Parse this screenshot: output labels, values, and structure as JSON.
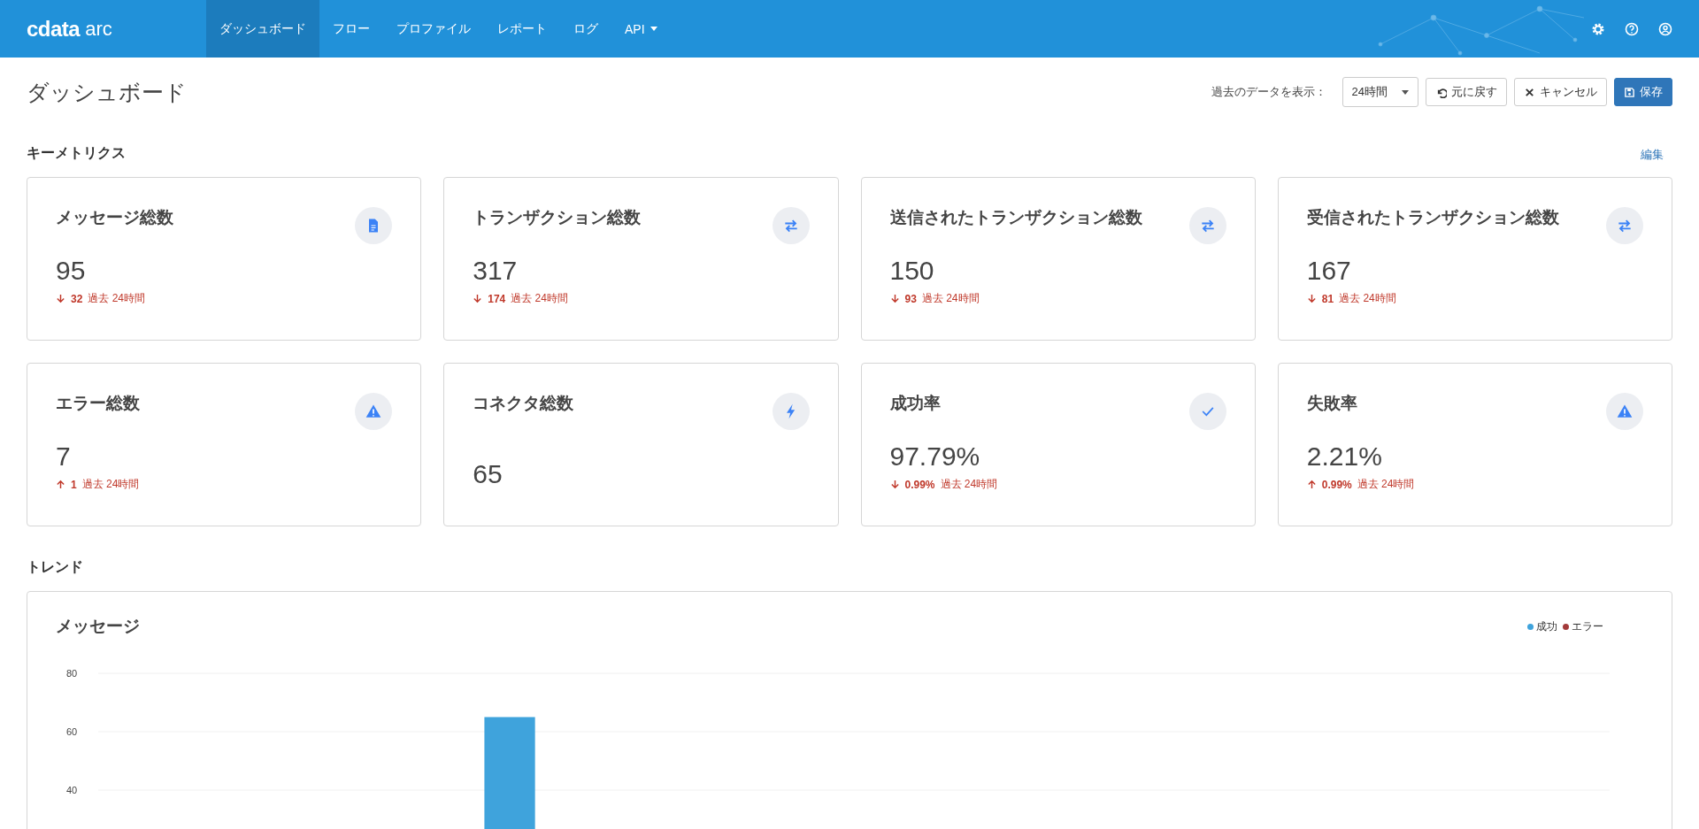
{
  "header": {
    "logo": {
      "brand": "cdata",
      "product": "arc"
    },
    "nav": [
      {
        "label": "ダッシュボード",
        "selected": true,
        "dropdown": false
      },
      {
        "label": "フロー",
        "selected": false,
        "dropdown": false
      },
      {
        "label": "プロファイル",
        "selected": false,
        "dropdown": false
      },
      {
        "label": "レポート",
        "selected": false,
        "dropdown": false
      },
      {
        "label": "ログ",
        "selected": false,
        "dropdown": false
      },
      {
        "label": "API",
        "selected": false,
        "dropdown": true
      }
    ]
  },
  "page": {
    "title": "ダッシュボード",
    "range_label": "過去のデータを表示：",
    "range_select": {
      "value": "24時間"
    },
    "buttons": [
      {
        "label": "元に戻す",
        "kind": "undo"
      },
      {
        "label": "キャンセル",
        "kind": "cancel"
      },
      {
        "label": "保存",
        "kind": "save"
      }
    ]
  },
  "key_metrics": {
    "title": "キーメトリクス",
    "edit_link": "編集",
    "cards": [
      {
        "title": "メッセージ総数",
        "kind": "document",
        "value": "95",
        "change": {
          "increase": false,
          "amount": "32",
          "period": "過去 24時間"
        }
      },
      {
        "title": "トランザクション総数",
        "kind": "exchange",
        "value": "317",
        "change": {
          "increase": false,
          "amount": "174",
          "period": "過去 24時間"
        }
      },
      {
        "title": "送信されたトランザクション総数",
        "kind": "exchange",
        "value": "150",
        "change": {
          "increase": false,
          "amount": "93",
          "period": "過去 24時間"
        }
      },
      {
        "title": "受信されたトランザクション総数",
        "kind": "exchange",
        "value": "167",
        "change": {
          "increase": false,
          "amount": "81",
          "period": "過去 24時間"
        }
      },
      {
        "title": "エラー総数",
        "kind": "warning",
        "value": "7",
        "change": {
          "increase": true,
          "amount": "1",
          "period": "過去 24時間"
        }
      },
      {
        "title": "コネクタ総数",
        "kind": "bolt",
        "value": "65"
      },
      {
        "title": "成功率",
        "kind": "check",
        "value": "97.79%",
        "change": {
          "increase": false,
          "amount": "0.99%",
          "period": "過去 24時間"
        }
      },
      {
        "title": "失敗率",
        "kind": "warning",
        "value": "2.21%",
        "change": {
          "increase": true,
          "amount": "0.99%",
          "period": "過去 24時間"
        }
      }
    ]
  },
  "trends": {
    "title": "トレンド",
    "chart_card": {
      "title": "メッセージ",
      "chart_data": {
        "type": "bar",
        "yticks": [
          40,
          60,
          80
        ],
        "ylim": [
          0,
          80
        ],
        "series": [
          {
            "name": "成功",
            "color": "#3fa3dc",
            "values": [
              null,
              null,
              null,
              null,
              null,
              null,
              65,
              null,
              null,
              null,
              null,
              null,
              null,
              null,
              null,
              null,
              null,
              null,
              null,
              null,
              null,
              null,
              null,
              null
            ]
          },
          {
            "name": "エラー",
            "color": "#a33a3a",
            "values": [
              null,
              null,
              null,
              null,
              null,
              null,
              null,
              null,
              null,
              null,
              null,
              null,
              null,
              null,
              null,
              null,
              null,
              null,
              null,
              null,
              null,
              null,
              null,
              null
            ]
          }
        ]
      }
    }
  }
}
